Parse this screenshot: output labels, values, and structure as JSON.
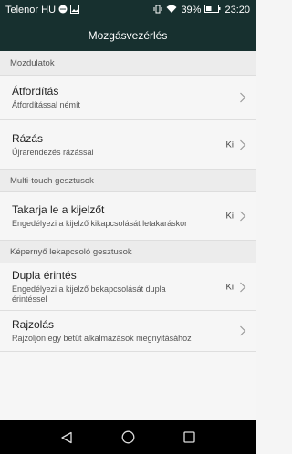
{
  "status_bar": {
    "carrier": "Telenor HU",
    "battery_percent": "39%",
    "time": "23:20",
    "icons": [
      "chat-icon",
      "image-icon",
      "vibrate-icon",
      "wifi-icon",
      "battery-icon"
    ]
  },
  "app_bar": {
    "title": "Mozgásvezérlés"
  },
  "sections": [
    {
      "header": "Mozdulatok",
      "items": [
        {
          "title": "Átfordítás",
          "subtitle": "Átfordítással némít",
          "value": ""
        },
        {
          "title": "Rázás",
          "subtitle": "Újrarendezés rázással",
          "value": "Ki"
        }
      ]
    },
    {
      "header": "Multi-touch gesztusok",
      "items": [
        {
          "title": "Takarja le a kijelzőt",
          "subtitle": "Engedélyezi a kijelző kikapcsolását letakaráskor",
          "value": "Ki"
        }
      ]
    },
    {
      "header": "Képernyő lekapcsoló gesztusok",
      "items": [
        {
          "title": "Dupla érintés",
          "subtitle": "Engedélyezi a kijelző bekapcsolását dupla érintéssel",
          "value": "Ki"
        },
        {
          "title": "Rajzolás",
          "subtitle": "Rajzoljon egy betűt alkalmazások megnyitásához",
          "value": ""
        }
      ]
    }
  ],
  "nav_bar": {
    "icons": [
      "back-icon",
      "home-icon",
      "recents-icon"
    ]
  }
}
